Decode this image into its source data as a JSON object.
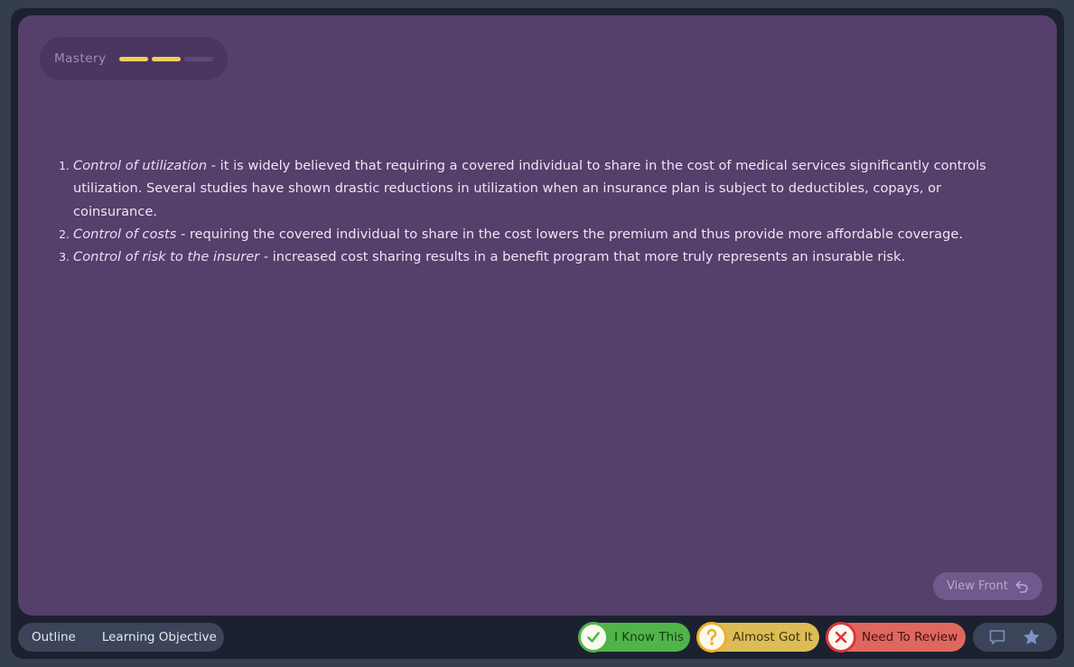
{
  "mastery": {
    "label": "Mastery",
    "level": 2,
    "max": 3,
    "color": "#f4cf5a"
  },
  "content": {
    "items": [
      {
        "term": "Control of utilization",
        "text": " - it is widely believed that requiring a covered individual to share in the cost of medical services significantly controls utilization. Several studies have shown drastic reductions in utilization when an insurance plan is subject to deductibles, copays, or coinsurance."
      },
      {
        "term": "Control of costs",
        "text": " - requiring the covered individual to share in the cost lowers the premium and thus provide more affordable coverage."
      },
      {
        "term": "Control of risk to the insurer",
        "text": " - increased cost sharing results in a benefit program that more truly represents an insurable risk."
      }
    ]
  },
  "view_front": {
    "label": "View Front",
    "icon": "flip-back-icon"
  },
  "bottom_nav": {
    "outline": "Outline",
    "learning_objective": "Learning Objective"
  },
  "rating": {
    "know": {
      "label": "I Know This",
      "icon": "check-icon",
      "color": "#4fb548"
    },
    "almost": {
      "label": "Almost Got It",
      "icon": "question-icon",
      "color": "#dcbc55"
    },
    "review": {
      "label": "Need To Review",
      "icon": "x-icon",
      "color": "#e0675e"
    }
  },
  "tools": {
    "comment_icon": "comment-icon",
    "star_icon": "star-icon"
  }
}
